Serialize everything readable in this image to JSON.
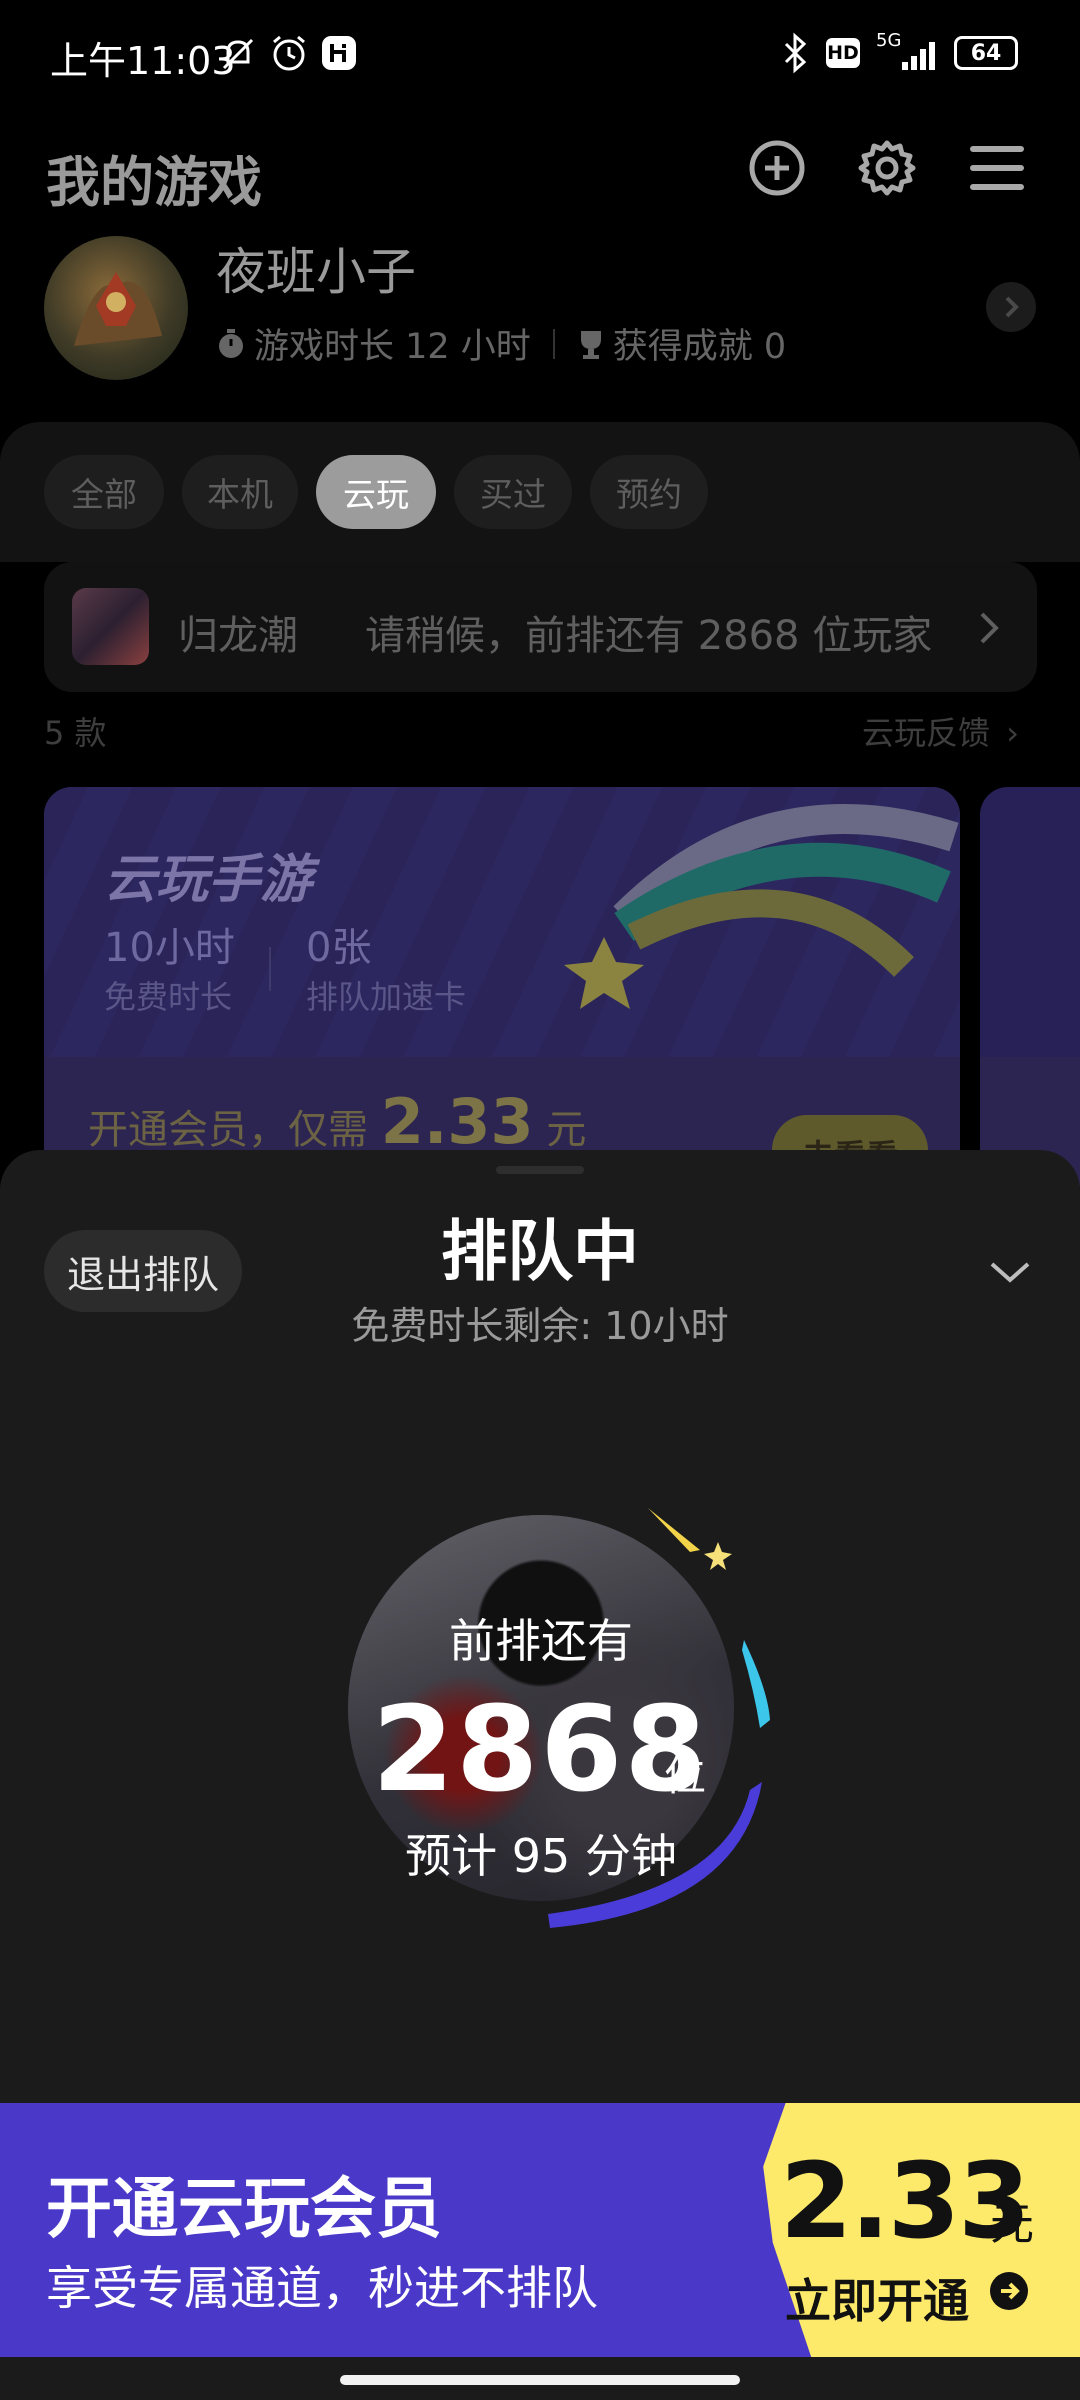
{
  "status_bar": {
    "time": "上午11:03",
    "battery": "64",
    "network": "5G",
    "hd": "HD"
  },
  "header": {
    "title": "我的游戏"
  },
  "profile": {
    "name": "夜班小子",
    "play_time": "游戏时长 12 小时",
    "achievements": "获得成就 0"
  },
  "tabs": [
    {
      "label": "全部"
    },
    {
      "label": "本机"
    },
    {
      "label": "云玩"
    },
    {
      "label": "买过"
    },
    {
      "label": "预约"
    }
  ],
  "active_tab": "云玩",
  "queue_banner": {
    "game": "归龙潮",
    "message": "请稍候，前排还有 2868 位玩家"
  },
  "list": {
    "count": "5 款",
    "feedback": "云玩反馈"
  },
  "card": {
    "title": "云玩手游",
    "free_time_value": "10小时",
    "free_time_label": "免费时长",
    "accel_value": "0张",
    "accel_label": "排队加速卡",
    "promo_prefix": "开通会员，仅需",
    "promo_price": "2.33",
    "promo_unit": "元",
    "button": "去看看"
  },
  "sheet": {
    "exit_button": "退出排队",
    "title": "排队中",
    "subtitle": "免费时长剩余: 10小时",
    "ahead_label": "前排还有",
    "queue_number": "2868",
    "queue_unit": "位",
    "eta": "预计 95 分钟"
  },
  "promo": {
    "title": "开通云玩会员",
    "subtitle": "享受专属通道，秒进不排队",
    "price": "2.33",
    "unit": "元",
    "cta": "立即开通"
  },
  "colors": {
    "accent_purple": "#4a39c9",
    "accent_yellow": "#fde96a",
    "sheet_bg": "#1b1b1b"
  }
}
